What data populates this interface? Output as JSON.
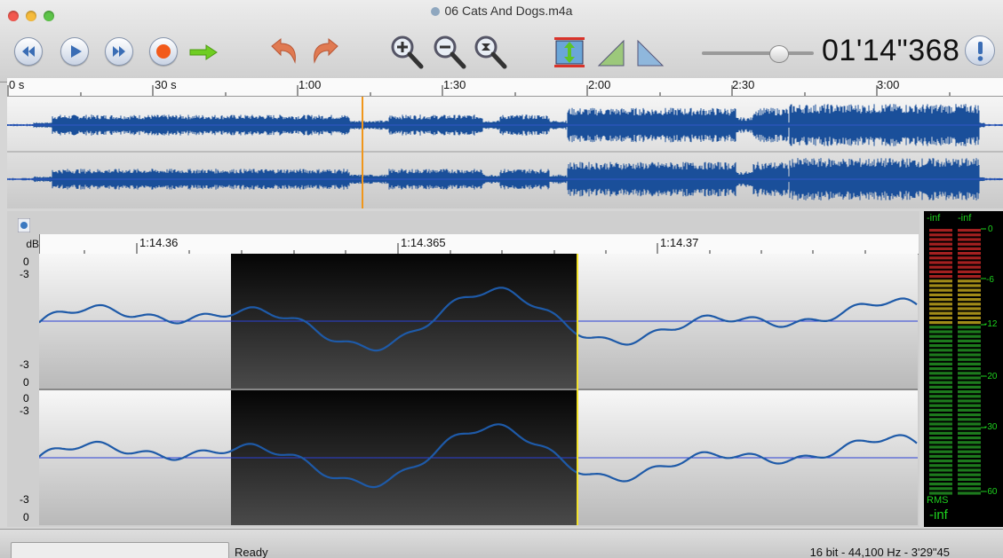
{
  "window": {
    "title": "06 Cats And Dogs.m4a",
    "traffic_lights": [
      "#f2584f",
      "#f6bb3b",
      "#5dc449"
    ]
  },
  "toolbar": {
    "buttons": [
      {
        "name": "rewind-button",
        "icon": "rewind-icon"
      },
      {
        "name": "play-button",
        "icon": "play-icon"
      },
      {
        "name": "fast-forward-button",
        "icon": "fast-forward-icon"
      },
      {
        "name": "record-button",
        "icon": "record-icon"
      },
      {
        "name": "go-to-button",
        "icon": "arrow-right-icon"
      },
      {
        "name": "undo-button",
        "icon": "undo-icon"
      },
      {
        "name": "redo-button",
        "icon": "redo-icon"
      },
      {
        "name": "zoom-in-button",
        "icon": "zoom-in-icon"
      },
      {
        "name": "zoom-out-button",
        "icon": "zoom-out-icon"
      },
      {
        "name": "zoom-selection-button",
        "icon": "zoom-selection-icon"
      },
      {
        "name": "normalize-button",
        "icon": "normalize-icon"
      },
      {
        "name": "fade-in-button",
        "icon": "fade-in-icon"
      },
      {
        "name": "fade-out-button",
        "icon": "fade-out-icon"
      },
      {
        "name": "info-button",
        "icon": "info-icon"
      }
    ],
    "volume_level": 0.83,
    "timecode": "01'14\"368"
  },
  "overview": {
    "ruler_labels": [
      "0 s",
      "30 s",
      "1:00",
      "1:30",
      "2:00",
      "2:30",
      "3:00"
    ],
    "playhead_time": "1:14.368"
  },
  "detail": {
    "ruler_unit": "dB",
    "ruler_labels": [
      "1:14.36",
      "1:14.365",
      "1:14.37"
    ],
    "channel_db_labels": [
      "0",
      "-3",
      "-3",
      "0"
    ]
  },
  "meter": {
    "peak_left": "-inf",
    "peak_right": "-inf",
    "scale": [
      "0",
      "-6",
      "-12",
      "-20",
      "-30",
      "-60"
    ],
    "rms_label": "RMS",
    "rms_value": "-inf",
    "colors": {
      "red": "#a32020",
      "yellow": "#a08a18",
      "green": "#1d7a1d"
    }
  },
  "status": {
    "text": "Ready",
    "info": "16 bit - 44,100 Hz - 3'29\"45"
  }
}
